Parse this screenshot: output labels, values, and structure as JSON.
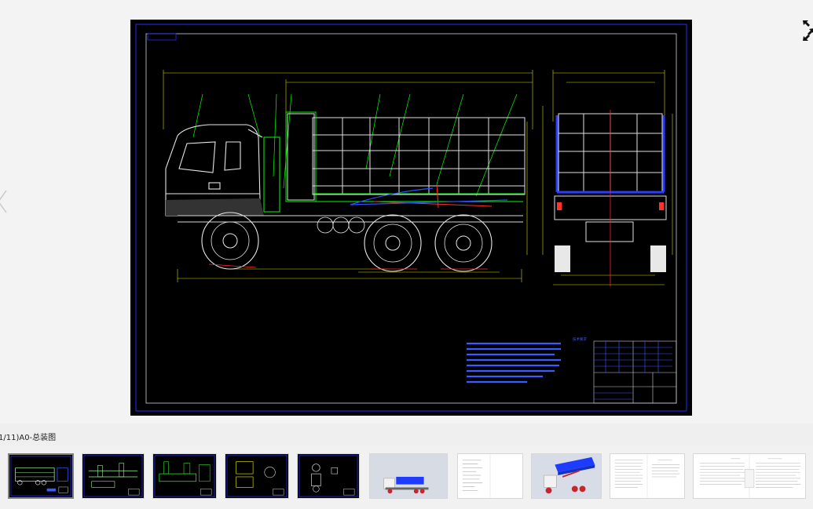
{
  "viewer": {
    "caption": "1/11)A0-总装图",
    "prev_icon": "chevron-left-icon",
    "fullscreen_icon": "fullscreen-icon"
  },
  "drawing": {
    "technical_requirements_title": "技术要求"
  },
  "thumbnails": [
    {
      "type": "cad-assembly",
      "active": true
    },
    {
      "type": "cad-drawing"
    },
    {
      "type": "cad-drawing"
    },
    {
      "type": "cad-drawing"
    },
    {
      "type": "cad-drawing"
    },
    {
      "type": "3d-render"
    },
    {
      "type": "document"
    },
    {
      "type": "3d-render"
    },
    {
      "type": "document"
    },
    {
      "type": "document"
    }
  ],
  "colors": {
    "cad_background": "#000000",
    "cad_frame": "#2020ff",
    "cad_lines": "#c8ffc8",
    "cad_green": "#00ff00",
    "cad_yellow": "#d8d800",
    "cad_red": "#ff2020",
    "accent_blue": "#1e3cff"
  }
}
